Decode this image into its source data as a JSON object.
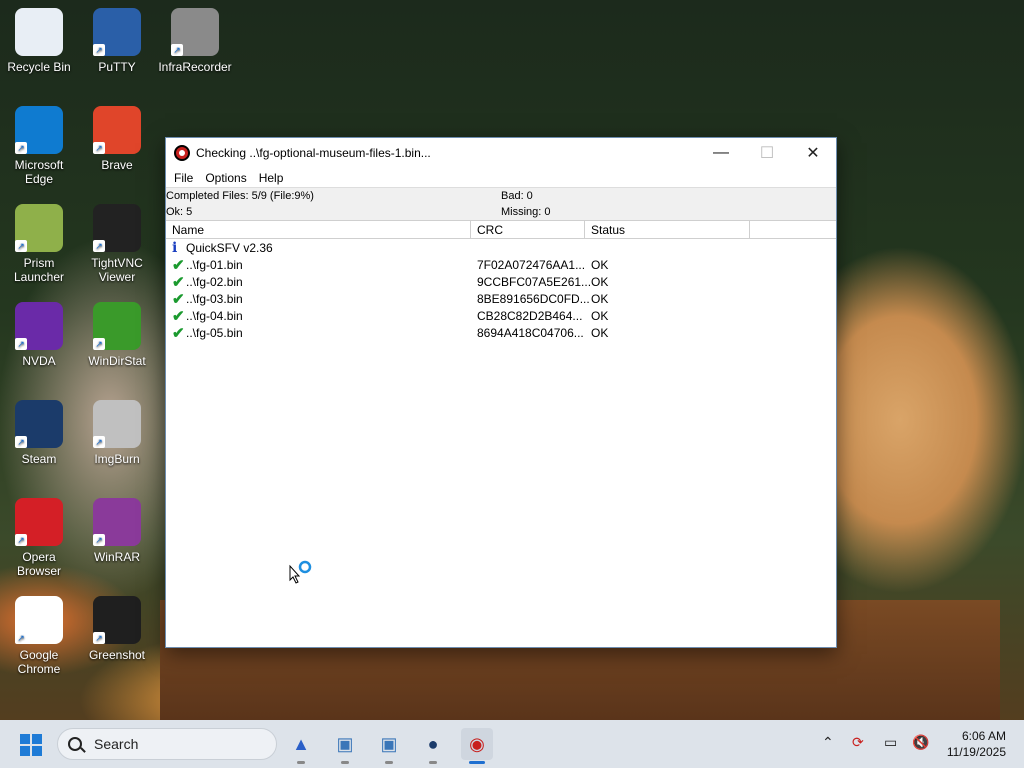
{
  "desktop": {
    "icons": [
      {
        "label": "Recycle Bin",
        "icon": "recycle-bin-icon"
      },
      {
        "label": "PuTTY",
        "icon": "putty-icon"
      },
      {
        "label": "InfraRecorder",
        "icon": "infrarecorder-icon"
      },
      {
        "label": "Microsoft Edge",
        "icon": "edge-icon"
      },
      {
        "label": "Brave",
        "icon": "brave-icon"
      },
      {
        "label": "Prism Launcher",
        "icon": "prism-icon"
      },
      {
        "label": "TightVNC Viewer",
        "icon": "tightvnc-icon"
      },
      {
        "label": "NVDA",
        "icon": "nvda-icon"
      },
      {
        "label": "WinDirStat",
        "icon": "windirstat-icon"
      },
      {
        "label": "Steam",
        "icon": "steam-icon"
      },
      {
        "label": "ImgBurn",
        "icon": "imgburn-icon"
      },
      {
        "label": "Opera Browser",
        "icon": "opera-icon"
      },
      {
        "label": "WinRAR",
        "icon": "winrar-icon"
      },
      {
        "label": "Google Chrome",
        "icon": "chrome-icon"
      },
      {
        "label": "Greenshot",
        "icon": "greenshot-icon"
      }
    ]
  },
  "window": {
    "title": "Checking ..\\fg-optional-museum-files-1.bin...",
    "controls": {
      "minimize": "—",
      "maximize": "☐",
      "close": "✕"
    },
    "menu": [
      "File",
      "Options",
      "Help"
    ],
    "status": {
      "completed": "Completed Files: 5/9 (File:9%)",
      "bad": "Bad: 0",
      "ok": "Ok: 5",
      "missing": "Missing: 0"
    },
    "columns": [
      "Name",
      "CRC",
      "Status"
    ],
    "header_row": "QuickSFV v2.36",
    "rows": [
      {
        "name": "..\\fg-01.bin",
        "crc": "7F02A072476AA1...",
        "status": "OK"
      },
      {
        "name": "..\\fg-02.bin",
        "crc": "9CCBFC07A5E261...",
        "status": "OK"
      },
      {
        "name": "..\\fg-03.bin",
        "crc": "8BE891656DC0FD...",
        "status": "OK"
      },
      {
        "name": "..\\fg-04.bin",
        "crc": "CB28C82D2B464...",
        "status": "OK"
      },
      {
        "name": "..\\fg-05.bin",
        "crc": "8694A418C04706...",
        "status": "OK"
      }
    ]
  },
  "taskbar": {
    "search_placeholder": "Search",
    "time": "6:06 AM",
    "date": "11/19/2025"
  }
}
